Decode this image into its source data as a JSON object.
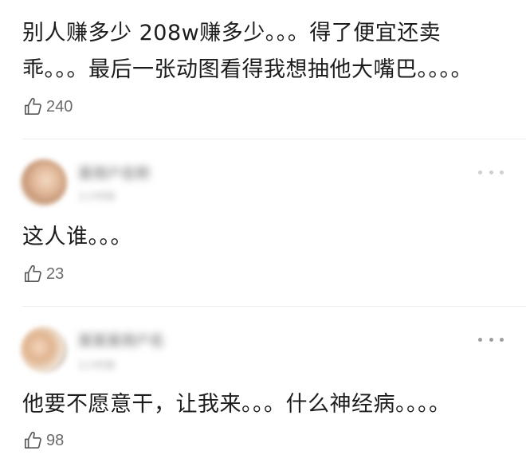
{
  "comments": [
    {
      "text_lines": [
        "别人赚多少 208w赚多少。。。得了便宜还卖",
        "乖。。。最后一张动图看得我想抽他大嘴巴。。。。"
      ],
      "likes": "240"
    },
    {
      "author": "某用户名称",
      "time": "1小时前",
      "text_lines": [
        "这人谁。。。"
      ],
      "likes": "23"
    },
    {
      "author": "某某某用户名",
      "time": "1小时前",
      "text_lines": [
        "他要不愿意干，让我来。。。什么神经病。。。。"
      ],
      "likes": "98"
    }
  ],
  "icons": {
    "like": "thumbs-up-outline-icon",
    "more": "more-dots-icon"
  },
  "colors": {
    "text": "#1c1c1c",
    "secondary": "#6b6b6b",
    "divider": "#ececec"
  }
}
